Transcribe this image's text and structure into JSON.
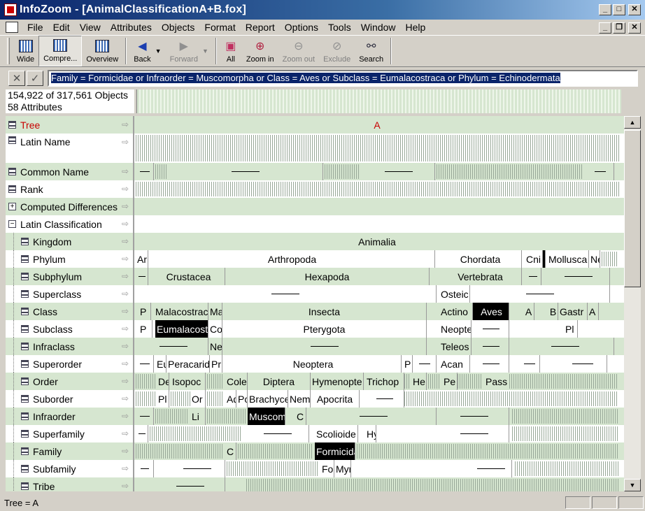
{
  "window": {
    "title": "InfoZoom - [AnimalClassificationA+B.fox]"
  },
  "menu": [
    "File",
    "Edit",
    "View",
    "Attributes",
    "Objects",
    "Format",
    "Report",
    "Options",
    "Tools",
    "Window",
    "Help"
  ],
  "toolbar": {
    "wide": "Wide",
    "compressed": "Compre...",
    "overview": "Overview",
    "back": "Back",
    "forward": "Forward",
    "all": "All",
    "zoom_in": "Zoom in",
    "zoom_out": "Zoom out",
    "exclude": "Exclude",
    "search": "Search"
  },
  "filter": {
    "query": "Family = Formicidae or Infraorder = Muscomorpha or Class = Aves or Subclass = Eumalacostraca or Phylum = Echinodermata"
  },
  "info": {
    "objects": "154,922 of 317,561 Objects",
    "attributes": "58 Attributes"
  },
  "rows": [
    {
      "label": "Tree",
      "cells": [
        "A"
      ]
    },
    {
      "label": "Latin Name",
      "cells": []
    },
    {
      "label": "Common Name",
      "cells": []
    },
    {
      "label": "Rank",
      "cells": []
    },
    {
      "label": "Computed Differences",
      "cells": []
    },
    {
      "label": "Latin Classification",
      "cells": []
    },
    {
      "label": "Kingdom",
      "cells": [
        "Animalia"
      ]
    },
    {
      "label": "Phylum",
      "cells": [
        "Ar",
        "Arthropoda",
        "Chordata",
        "Cni",
        "Mollusca",
        "Ne"
      ]
    },
    {
      "label": "Subphylum",
      "cells": [
        "Crustacea",
        "Hexapoda",
        "Vertebrata"
      ]
    },
    {
      "label": "Superclass",
      "cells": [
        "Osteic"
      ]
    },
    {
      "label": "Class",
      "cells": [
        "P",
        "Malacostrac",
        "Ma",
        "Insecta",
        "Actino",
        "Aves",
        "A",
        "B",
        "Gastr",
        "A"
      ]
    },
    {
      "label": "Subclass",
      "cells": [
        "P",
        "Eumalacost",
        "Co",
        "Pterygota",
        "Neopte",
        "Pl"
      ]
    },
    {
      "label": "Infraclass",
      "cells": [
        "Ne",
        "Teleos"
      ]
    },
    {
      "label": "Superorder",
      "cells": [
        "Eu",
        "Peracarid",
        "Pr",
        "Neoptera",
        "P",
        "Acan"
      ]
    },
    {
      "label": "Order",
      "cells": [
        "De",
        "Isopoc",
        "Cole",
        "Diptera",
        "Hymenopte",
        "Trichop",
        "He",
        "Pe",
        "Pass"
      ]
    },
    {
      "label": "Suborder",
      "cells": [
        "Pl",
        "Or",
        "Ad",
        "Pc",
        "Brachyce",
        "Nem",
        "Apocrita"
      ]
    },
    {
      "label": "Infraorder",
      "cells": [
        "Li",
        "Muscom",
        "C"
      ]
    },
    {
      "label": "Superfamily",
      "cells": [
        "Scolioide",
        "Hy"
      ]
    },
    {
      "label": "Family",
      "cells": [
        "C",
        "Formicida"
      ]
    },
    {
      "label": "Subfamily",
      "cells": [
        "Fo",
        "Myr"
      ]
    },
    {
      "label": "Tribe",
      "cells": []
    }
  ],
  "status": {
    "text": "Tree = A"
  }
}
